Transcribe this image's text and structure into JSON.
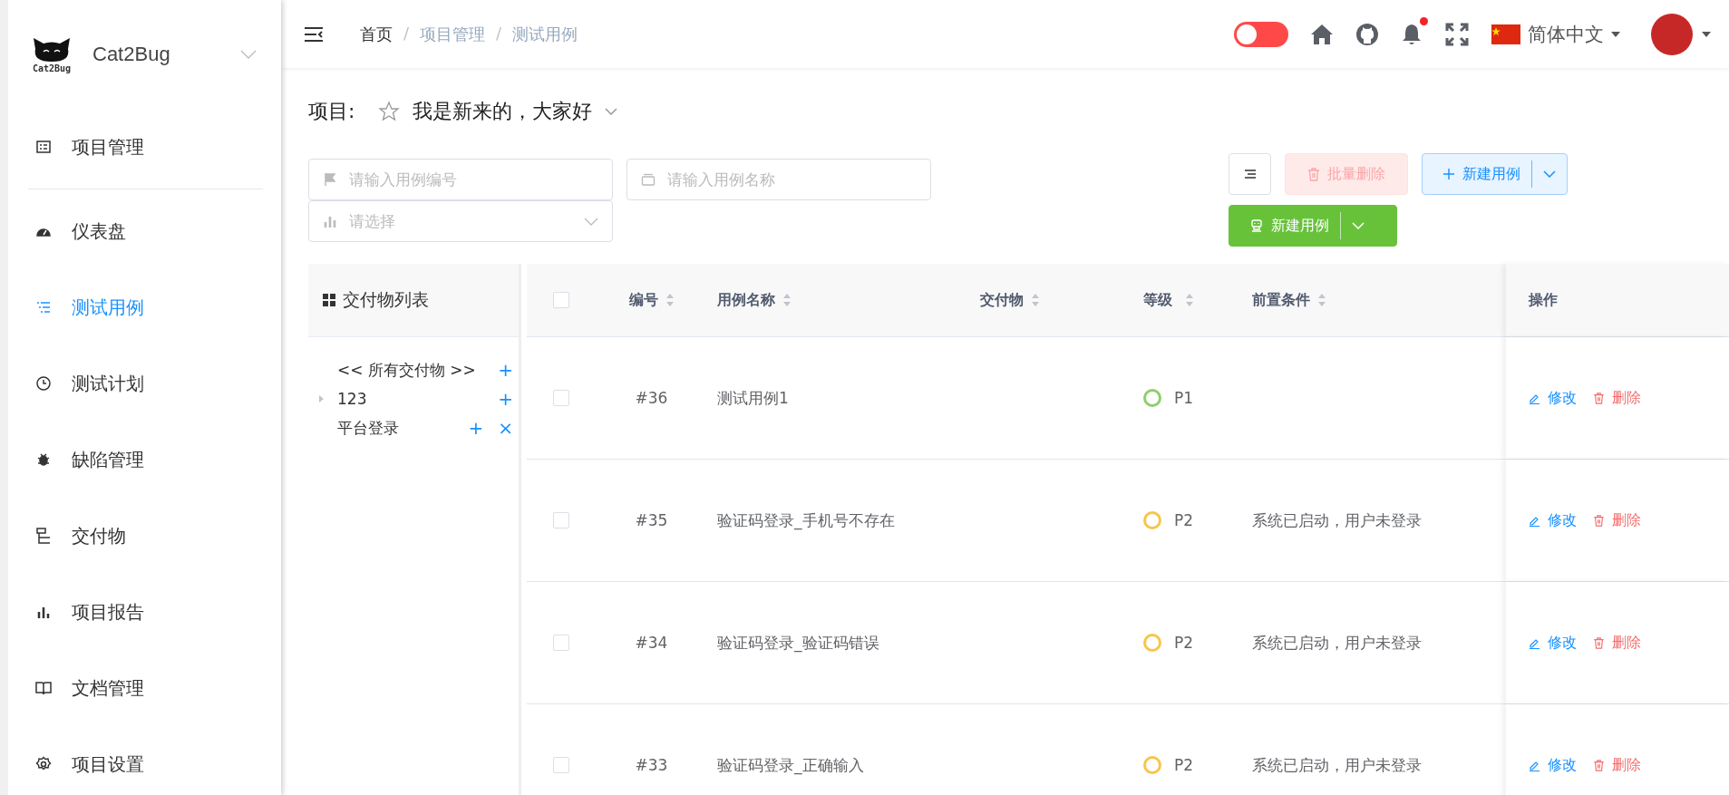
{
  "sidebar": {
    "app_name": "Cat2Bug",
    "logo_text": "Cat2Bug",
    "items": [
      {
        "label": "项目管理",
        "selected": false
      },
      {
        "label": "仪表盘",
        "selected": false
      },
      {
        "label": "测试用例",
        "selected": true
      },
      {
        "label": "测试计划",
        "selected": false
      },
      {
        "label": "缺陷管理",
        "selected": false
      },
      {
        "label": "交付物",
        "selected": false
      },
      {
        "label": "项目报告",
        "selected": false
      },
      {
        "label": "文档管理",
        "selected": false
      },
      {
        "label": "项目设置",
        "selected": false
      }
    ]
  },
  "breadcrumb": {
    "separator": "/",
    "items": [
      "首页",
      "项目管理",
      "测试用例"
    ]
  },
  "header": {
    "theme_switch": {
      "on": false
    },
    "notification_dot": true,
    "language": "简体中文"
  },
  "project": {
    "label": "项目:",
    "name": "我是新来的，大家好",
    "starred": false
  },
  "filters": [
    {
      "kind": "input",
      "placeholder": "请输入用例编号"
    },
    {
      "kind": "input",
      "placeholder": "请输入用例名称"
    },
    {
      "kind": "select",
      "placeholder": "请选择"
    }
  ],
  "actions": [
    {
      "kind": "icon"
    },
    {
      "kind": "danger",
      "label": "批量删除",
      "disabled": true
    },
    {
      "kind": "primary-split",
      "label": "新建用例",
      "disabled": false
    },
    {
      "kind": "success-split",
      "label": "新建用例",
      "disabled": false
    }
  ],
  "deliverables": {
    "title": "交付物列表",
    "items": [
      {
        "label": "<< 所有交付物 >>",
        "add": "+",
        "has_children": false
      },
      {
        "label": "123",
        "add": "+",
        "has_children": true
      },
      {
        "label": "平台登录",
        "add": "+",
        "remove": "×",
        "has_children": false
      }
    ]
  },
  "table": {
    "all_checked": false,
    "columns": [
      "编号",
      "用例名称",
      "交付物",
      "等级",
      "前置条件",
      "操作"
    ],
    "rows": [
      {
        "checked": false,
        "id": "#36",
        "name": "测试用例1",
        "level": "P1",
        "color": "#8fcd6b",
        "edit": "修改",
        "delete": "删除"
      },
      {
        "checked": false,
        "id": "#35",
        "name": "验证码登录_手机号不存在",
        "level": "P2",
        "color": "#f7c54c",
        "precondition": "系统已启动，用户未登录",
        "edit": "修改",
        "delete": "删除"
      },
      {
        "checked": false,
        "id": "#34",
        "name": "验证码登录_验证码错误",
        "level": "P2",
        "color": "#f7c54c",
        "precondition": "系统已启动，用户未登录",
        "edit": "修改",
        "delete": "删除"
      },
      {
        "checked": false,
        "id": "#33",
        "name": "验证码登录_正确输入",
        "level": "P2",
        "color": "#f7c54c",
        "precondition": "系统已启动，用户未登录",
        "edit": "修改",
        "delete": "删除"
      }
    ]
  }
}
